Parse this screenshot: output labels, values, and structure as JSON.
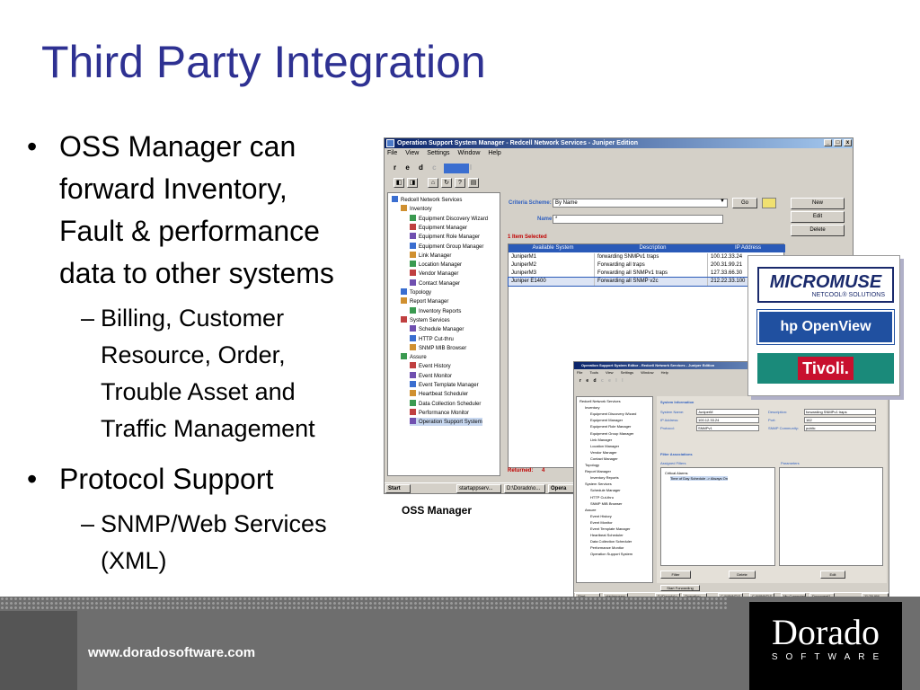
{
  "slide": {
    "title": "Third Party Integration",
    "bullets": [
      {
        "lines": [
          "OSS Manager can",
          "forward Inventory,",
          "Fault & performance",
          "data to other systems"
        ],
        "sub": [
          {
            "lines": [
              "Billing, Customer",
              "Resource, Order,",
              "Trouble Asset and",
              "Traffic Management"
            ]
          }
        ]
      },
      {
        "lines": [
          "Protocol Support"
        ],
        "sub": [
          {
            "lines": [
              "SNMP/Web Services",
              "(XML)"
            ]
          }
        ]
      }
    ],
    "bullet_char": "•",
    "dash_char": "–",
    "caption": "OSS Manager",
    "footer_url": "www.doradosoftware.com",
    "footer_logo": {
      "name": "Dorado",
      "tagline": "SOFTWARE"
    }
  },
  "vendors": [
    {
      "name": "MICROMUSE",
      "tagline": "NETCOOL® SOLUTIONS",
      "color": "#1a2a6c"
    },
    {
      "name": "hp OpenView",
      "color": "#2050a0"
    },
    {
      "name": "Tivoli.",
      "color": "#c8102e",
      "bg": "#1a8a7a"
    }
  ],
  "window1": {
    "title": "Operation Support System Manager - Redcell Network Services - Juniper Edition",
    "menu": [
      "File",
      "View",
      "Settings",
      "Window",
      "Help"
    ],
    "logo": {
      "left": "r e d",
      "right": "c e l l"
    },
    "tree": [
      {
        "label": "Redcell Network Services",
        "level": 0,
        "icon": "network-icon"
      },
      {
        "label": "Inventory",
        "level": 1,
        "icon": "folder-icon"
      },
      {
        "label": "Equipment Discovery Wizard",
        "level": 2,
        "icon": "wizard-icon"
      },
      {
        "label": "Equipment Manager",
        "level": 2,
        "icon": "equipment-icon"
      },
      {
        "label": "Equipment Role Manager",
        "level": 2,
        "icon": "role-icon"
      },
      {
        "label": "Equipment Group Manager",
        "level": 2,
        "icon": "group-icon"
      },
      {
        "label": "Link Manager",
        "level": 2,
        "icon": "link-icon"
      },
      {
        "label": "Location Manager",
        "level": 2,
        "icon": "location-icon"
      },
      {
        "label": "Vendor Manager",
        "level": 2,
        "icon": "vendor-icon"
      },
      {
        "label": "Contact Manager",
        "level": 2,
        "icon": "contact-icon"
      },
      {
        "label": "Topology",
        "level": 1,
        "icon": "folder-icon"
      },
      {
        "label": "Report Manager",
        "level": 1,
        "icon": "folder-icon"
      },
      {
        "label": "Inventory Reports",
        "level": 2,
        "icon": "report-icon"
      },
      {
        "label": "System Services",
        "level": 1,
        "icon": "folder-icon"
      },
      {
        "label": "Schedule Manager",
        "level": 2,
        "icon": "schedule-icon"
      },
      {
        "label": "HTTP Cut-thru",
        "level": 2,
        "icon": "http-icon"
      },
      {
        "label": "SNMP MIB Browser",
        "level": 2,
        "icon": "mib-icon"
      },
      {
        "label": "Assure",
        "level": 1,
        "icon": "folder-icon"
      },
      {
        "label": "Event History",
        "level": 2,
        "icon": "event-icon"
      },
      {
        "label": "Event Monitor",
        "level": 2,
        "icon": "monitor-icon"
      },
      {
        "label": "Event Template Manager",
        "level": 2,
        "icon": "template-icon"
      },
      {
        "label": "Heartbeat Scheduler",
        "level": 2,
        "icon": "heartbeat-icon"
      },
      {
        "label": "Data Collection Scheduler",
        "level": 2,
        "icon": "collection-icon"
      },
      {
        "label": "Performance Monitor",
        "level": 2,
        "icon": "performance-icon"
      },
      {
        "label": "Operation Support System",
        "level": 2,
        "icon": "oss-icon"
      }
    ],
    "criteria_label": "Criteria Scheme:",
    "criteria_value": "By Name",
    "go_label": "Go",
    "name_label": "Name:",
    "name_value": "*",
    "selected_text": "1 Item Selected",
    "columns": [
      "Available System",
      "Description",
      "IP Address"
    ],
    "rows": [
      [
        "JuniperM1",
        "forwarding SNMPv1 traps",
        "100.12.33.24"
      ],
      [
        "JuniperM2",
        "Forwarding all traps",
        "200.31.99.21"
      ],
      [
        "JuniperM3",
        "Forwarding all SNMPv1 traps",
        "127.33.66.30"
      ],
      [
        "Juniper E1400",
        "Forwarding all SNMP v2c",
        "212.22.33.100"
      ]
    ],
    "actions": [
      "New",
      "Edit",
      "Delete"
    ],
    "returned_label": "Returned:",
    "returned_value": "4",
    "taskbar": [
      "Start",
      "startappserv...",
      "D:\\Dorado\\o...",
      "Opera"
    ]
  },
  "window2": {
    "title": "Operation Support System Editor - Redcell Network Services - Juniper Edition",
    "menu": [
      "File",
      "Tools",
      "View",
      "Settings",
      "Window",
      "Help"
    ],
    "sections": [
      "System Information",
      "Filter Associations",
      "Assigned Filters",
      "Parameters"
    ],
    "fields": [
      {
        "label": "System Name:",
        "value": "JuniperM"
      },
      {
        "label": "IP Address:",
        "value": "100.12.33.24"
      },
      {
        "label": "Protocol:",
        "value": "SNMPv1"
      },
      {
        "label": "Description:",
        "value": "forwarding SNMPv1 traps"
      },
      {
        "label": "Port:",
        "value": "162"
      },
      {
        "label": "SNMP Community:",
        "value": "public"
      }
    ],
    "filters": [
      "Critical Alarms",
      "Time of Day Schedule -> Always On"
    ],
    "buttons": [
      "Filter",
      "Delete",
      "Edit",
      "Start Forwarding"
    ],
    "taskbar": [
      "Start",
      "startappserv...",
      "D:\\Dorado\\o...",
      "Operation ...",
      "C:\\WINNT\\S...",
      "C:\\WINNT\\S...",
      "My Computer",
      "Document1 -",
      "11:29 AM"
    ]
  }
}
